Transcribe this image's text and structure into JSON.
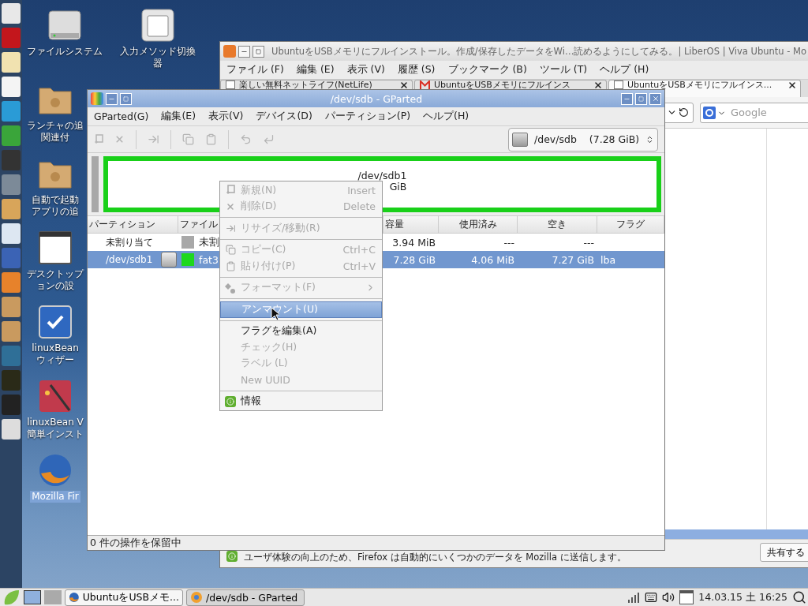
{
  "desktop_icons": [
    {
      "kind": "drive",
      "lines": [
        "ファイルシステム"
      ],
      "selected": false
    },
    {
      "kind": "keyboard",
      "lines": [
        "入力メソッド切換",
        "器"
      ],
      "selected": false
    },
    {
      "kind": "folder",
      "lines": [
        "ランチャの追",
        "関連付"
      ],
      "selected": false
    },
    {
      "kind": "folder",
      "lines": [
        "自動で起動",
        "アプリの追"
      ],
      "selected": false
    },
    {
      "kind": "window",
      "lines": [
        "デスクトップ",
        "ョンの設"
      ],
      "selected": false
    },
    {
      "kind": "check",
      "lines": [
        "linuxBean",
        "ウィザー"
      ],
      "selected": false
    },
    {
      "kind": "wand",
      "lines": [
        "linuxBean V",
        "簡単インスト"
      ],
      "selected": false
    },
    {
      "kind": "globe",
      "lines": [
        "Mozilla Fir"
      ],
      "selected": true
    }
  ],
  "firefox": {
    "title": "UbuntuをUSBメモリにフルインストール。作成/保存したデータをWi…読めるようにしてみる。| LiberOS | Viva Ubuntu - Mo",
    "menu": [
      "ファイル (F)",
      "編集 (E)",
      "表示 (V)",
      "履歴 (S)",
      "ブックマーク (B)",
      "ツール (T)",
      "ヘルプ (H)"
    ],
    "tabs": [
      {
        "kind": "page",
        "label": "楽しい無料ネットライフ(NetLife)",
        "selected": false
      },
      {
        "kind": "mail",
        "label": "UbuntuをUSBメモリにフルインス",
        "selected": false
      },
      {
        "kind": "page",
        "label": "UbuntuをUSBメモリにフルインス...",
        "selected": true
      }
    ],
    "search": {
      "placeholder": "Google"
    },
    "notification": {
      "text": "ユーザ体験の向上のため、Firefox は自動的にいくつかのデータを Mozilla に送信します。",
      "button": "共有する"
    }
  },
  "gparted": {
    "title": "/dev/sdb - GParted",
    "menu": [
      "GParted(G)",
      "編集(E)",
      "表示(V)",
      "デバイス(D)",
      "パーティション(P)",
      "ヘルプ(H)"
    ],
    "device": {
      "name": "/dev/sdb",
      "size": "(7.28 GiB)"
    },
    "map": {
      "name": "/dev/sdb1",
      "size": "GiB"
    },
    "columns": [
      "パーティション",
      "ファイル",
      "容量",
      "使用済み",
      "空き",
      "フラグ"
    ],
    "rows": [
      {
        "partition": "未割り当て",
        "filesystem": "未割",
        "color": "#a8a8a8",
        "mounted": false,
        "size": "3.94 MiB",
        "used": "---",
        "unused": "---",
        "selected": false
      },
      {
        "partition": "/dev/sdb1",
        "filesystem": "fat3",
        "color": "#1ed81e",
        "mounted": true,
        "size": "7.28 GiB",
        "used": "4.06 MiB",
        "unused": "7.27 GiB",
        "flags": "lba",
        "selected": true
      }
    ],
    "status": "0 件の操作を保留中"
  },
  "context_menu": {
    "items": [
      {
        "kind": "item",
        "label": "新規(N)",
        "shortcut": "Insert",
        "disabled": true,
        "selected": false
      },
      {
        "kind": "item",
        "label": "削除(D)",
        "shortcut": "Delete",
        "disabled": true,
        "selected": false
      },
      {
        "kind": "separator"
      },
      {
        "kind": "item",
        "label": "リサイズ/移動(R)",
        "disabled": true,
        "selected": false
      },
      {
        "kind": "separator"
      },
      {
        "kind": "item",
        "label": "コピー(C)",
        "shortcut": "Ctrl+C",
        "disabled": true,
        "selected": false
      },
      {
        "kind": "item",
        "label": "貼り付け(P)",
        "shortcut": "Ctrl+V",
        "disabled": true,
        "selected": false
      },
      {
        "kind": "separator"
      },
      {
        "kind": "submenu",
        "label": "フォーマット(F)",
        "disabled": true,
        "selected": false
      },
      {
        "kind": "separator"
      },
      {
        "kind": "item",
        "label": "アンマウント(U)",
        "disabled": false,
        "selected": true
      },
      {
        "kind": "separator"
      },
      {
        "kind": "item",
        "label": "フラグを編集(A)",
        "disabled": false,
        "selected": false
      },
      {
        "kind": "item",
        "label": "チェック(H)",
        "disabled": true,
        "selected": false
      },
      {
        "kind": "item",
        "label": "ラベル (L)",
        "disabled": true,
        "selected": false
      },
      {
        "kind": "item",
        "label": "New UUID",
        "disabled": true,
        "selected": false
      },
      {
        "kind": "separator"
      },
      {
        "kind": "item",
        "label": "情報",
        "disabled": false,
        "selected": false
      }
    ]
  },
  "taskbar": {
    "workspaces": [
      {
        "selected": true
      },
      {
        "selected": false
      }
    ],
    "tasks": [
      {
        "kind": "firefox",
        "label": "UbuntuをUSBメモ...",
        "selected": false
      },
      {
        "kind": "gparted",
        "label": "/dev/sdb - GParted",
        "selected": true
      }
    ],
    "clock": "14.03.15 土 16:25"
  }
}
